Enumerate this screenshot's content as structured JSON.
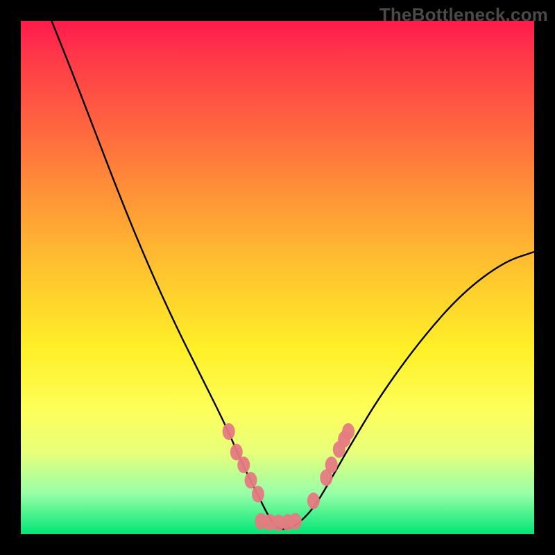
{
  "watermark": "TheBottleneck.com",
  "colors": {
    "background": "#000000",
    "gradient_top": "#ff1a4d",
    "gradient_bottom": "#00e676",
    "curve": "#000000",
    "dot": "#e67a82"
  },
  "chart_data": {
    "type": "line",
    "title": "",
    "xlabel": "",
    "ylabel": "",
    "xlim": [
      0,
      100
    ],
    "ylim": [
      0,
      100
    ],
    "grid": false,
    "legend": false,
    "series": [
      {
        "name": "bottleneck-curve",
        "x": [
          6,
          10,
          15,
          20,
          25,
          30,
          35,
          40,
          43,
          46,
          48.5,
          50,
          52,
          54,
          57,
          60,
          64,
          70,
          78,
          86,
          94,
          100
        ],
        "y": [
          100,
          90,
          77,
          64,
          52,
          41,
          31,
          21,
          14,
          8,
          3,
          1,
          1,
          2,
          5,
          10,
          17,
          27,
          38,
          47,
          53,
          55
        ]
      }
    ],
    "markers": [
      {
        "x": 40.5,
        "y": 20
      },
      {
        "x": 42.0,
        "y": 16
      },
      {
        "x": 43.4,
        "y": 13.5
      },
      {
        "x": 44.8,
        "y": 10.5
      },
      {
        "x": 46.2,
        "y": 7.8
      },
      {
        "x": 46.8,
        "y": 2.5
      },
      {
        "x": 48.5,
        "y": 2.3
      },
      {
        "x": 50.2,
        "y": 2.2
      },
      {
        "x": 52.0,
        "y": 2.3
      },
      {
        "x": 53.5,
        "y": 2.5
      },
      {
        "x": 57.0,
        "y": 6.5
      },
      {
        "x": 59.5,
        "y": 11
      },
      {
        "x": 60.5,
        "y": 13.5
      },
      {
        "x": 62.0,
        "y": 16.5
      },
      {
        "x": 63.0,
        "y": 18.5
      },
      {
        "x": 63.8,
        "y": 20
      }
    ]
  }
}
